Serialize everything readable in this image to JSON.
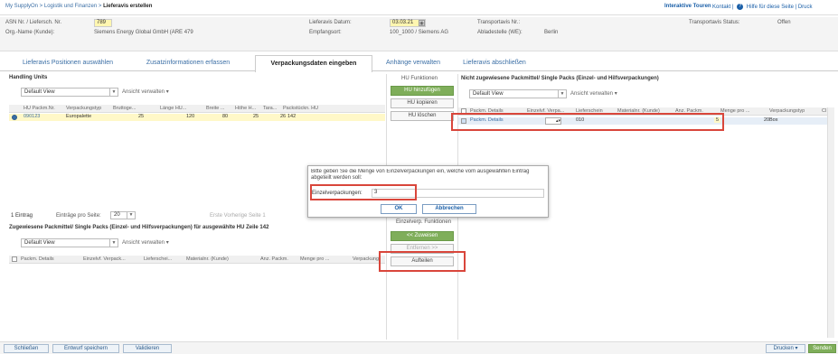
{
  "topbar": {
    "breadcrumb_prefix": "My SupplyOn > Logistik und Finanzen > ",
    "breadcrumb_current": "Lieferavis erstellen",
    "tours": "Interaktive Touren",
    "contact": "Kontakt |",
    "help": "Hilfe für diese Seite | Druck"
  },
  "header": {
    "asn_label": "ASN Nr. / Liefersch. Nr.",
    "asn_value": "789",
    "org_label": "Org.-Name (Kunde):",
    "org_value": "Siemens Energy Global GmbH (ARE 479",
    "date_label": "Lieferavis Datum:",
    "date_value": "03.03.21",
    "recipient_label": "Empfangsort:",
    "recipient_value": "100_1000 / Siemens AG",
    "transport_label": "Transportavis Nr.:",
    "unloading_label": "Abladestelle (WE):",
    "unloading_value": "Berlin",
    "status_label": "Transportavis Status:",
    "status_value": "Offen"
  },
  "tabs": [
    {
      "label": "Lieferavis Positionen auswählen"
    },
    {
      "label": "Zusatzinformationen erfassen"
    },
    {
      "label": "Verpackungsdaten eingeben"
    },
    {
      "label": "Anhänge verwalten"
    },
    {
      "label": "Lieferavis abschließen"
    }
  ],
  "hu_panel": {
    "title": "Handling Units",
    "view": "Default View",
    "manage": "Ansicht verwalten",
    "columns": [
      "HU Packm.Nr.",
      "Verpackungstyp",
      "Bruttoge...",
      "Länge HU...",
      "Breite ...",
      "Höhe H...",
      "Tara...",
      "Packstückn. HU"
    ],
    "row": [
      "090123",
      "Europalette",
      "25",
      "120",
      "80",
      "25",
      "26",
      "142"
    ],
    "entries": "1 Eintrag",
    "per_page_label": "Einträge pro Seite:",
    "per_page": "20",
    "pager": "Erste   Vorherige   Seite   1"
  },
  "hu_functions": {
    "title": "HU Funktionen",
    "add": "HU hinzufügen",
    "copy": "HU kopieren",
    "delete": "HU löschen"
  },
  "unassigned_panel": {
    "title": "Nicht zugewiesene Packmittel/ Single Packs (Einzel- und Hilfsverpackungen)",
    "view": "Default View",
    "manage": "Ansicht verwalten",
    "columns": [
      "Packm. Details",
      "Einzelvf. Verpa...",
      "Lieferschein",
      "Materialnr. (Kunde)",
      "Anz. Packm.",
      "Menge pro ...",
      "Verpackungstyp",
      "Cl"
    ],
    "row": {
      "details": "Packm. Details",
      "code": "010",
      "count": "5",
      "qty": "20",
      "type": "Box"
    }
  },
  "assigned_panel": {
    "title": "Zugewiesene Packmittel/ Single Packs (Einzel- und Hilfsverpackungen) für ausgewählte HU Zeile 142",
    "view": "Default View",
    "manage": "Ansicht verwalten",
    "columns": [
      "Packm. Details",
      "Einzelvf. Verpack...",
      "Lieferschei...",
      "Materialnr. (Kunde)",
      "Anz. Packm.",
      "Menge pro ...",
      "Verpackung"
    ]
  },
  "single_functions": {
    "title": "Einzelverp. Funktionen",
    "assign": "<< Zuweisen",
    "remove": "Entfernen >>",
    "split": "Aufteilen"
  },
  "dialog": {
    "message": "Bitte geben Sie die Menge von Einzelverpackungen ein, welche vom ausgewählten Eintrag abgeteilt werden soll:",
    "field_label": "Einzelverpackungen:",
    "field_value": "3",
    "ok": "OK",
    "cancel": "Abbrechen"
  },
  "footer": {
    "close": "Schließen",
    "save_draft": "Entwurf speichern",
    "validate": "Validieren",
    "print": "Drucken",
    "send": "Senden"
  },
  "colors": {
    "accent_green": "#7fae5a",
    "highlight_red": "#d9463b",
    "row_yellow": "#fff8c8",
    "link_blue": "#1a5fa8"
  }
}
